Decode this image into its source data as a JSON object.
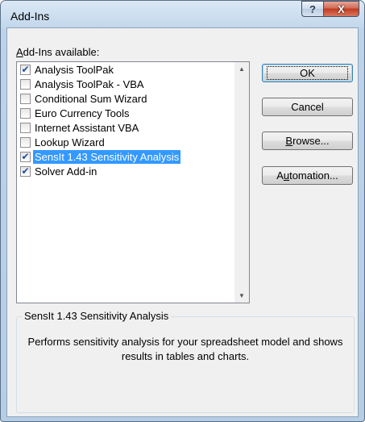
{
  "window": {
    "title": "Add-Ins",
    "help_glyph": "?",
    "close_glyph": "X"
  },
  "list": {
    "label": "Add-Ins available:",
    "items": [
      {
        "label": "Analysis ToolPak",
        "checked": true,
        "selected": false
      },
      {
        "label": "Analysis ToolPak - VBA",
        "checked": false,
        "selected": false
      },
      {
        "label": "Conditional Sum Wizard",
        "checked": false,
        "selected": false
      },
      {
        "label": "Euro Currency Tools",
        "checked": false,
        "selected": false
      },
      {
        "label": "Internet Assistant VBA",
        "checked": false,
        "selected": false
      },
      {
        "label": "Lookup Wizard",
        "checked": false,
        "selected": false
      },
      {
        "label": "SensIt 1.43 Sensitivity Analysis",
        "checked": true,
        "selected": true
      },
      {
        "label": "Solver Add-in",
        "checked": true,
        "selected": false
      }
    ]
  },
  "buttons": {
    "ok": "OK",
    "cancel": "Cancel",
    "browse": "Browse...",
    "automation": "Automation..."
  },
  "description": {
    "title": "SensIt 1.43 Sensitivity Analysis",
    "text": "Performs sensitivity analysis for your spreadsheet model and shows results in tables and charts."
  },
  "icons": {
    "check": "check-icon",
    "help": "help-icon",
    "close": "close-icon",
    "scroll_up": "scroll-up-arrow-icon",
    "scroll_down": "scroll-down-arrow-icon"
  }
}
